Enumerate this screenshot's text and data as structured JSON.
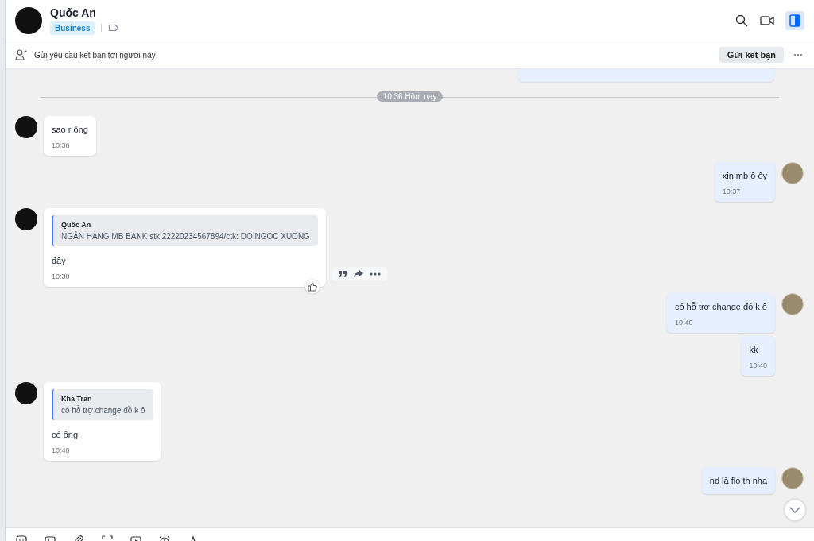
{
  "header": {
    "name": "Quốc An",
    "tag": "Business"
  },
  "friend_bar": {
    "text": "Gửi yêu cầu kết bạn tới người này",
    "button": "Gửi kết bạn"
  },
  "divider": "10:36 Hôm nay",
  "messages": [
    {
      "kind": "incoming",
      "show_avatar": true,
      "hovered": false,
      "text": "sao r ông",
      "time": "10:36"
    },
    {
      "kind": "outgoing",
      "show_avatar": true,
      "hovered": false,
      "text": "xin mb ô êy",
      "time": "10:37"
    },
    {
      "kind": "incoming",
      "show_avatar": true,
      "hovered": true,
      "quote": {
        "author": "Quốc An",
        "text": "NGÂN HÀNG MB BANK stk:22220234567894/ctk: DO NGOC XUONG"
      },
      "text": "đây",
      "time": "10:38"
    },
    {
      "kind": "outgoing",
      "show_avatar": true,
      "hovered": false,
      "text": "có hỗ trợ change đồ k ô",
      "time": "10:40"
    },
    {
      "kind": "outgoing",
      "show_avatar": false,
      "hovered": false,
      "text": "kk",
      "time": "10:40"
    },
    {
      "kind": "incoming",
      "show_avatar": true,
      "hovered": false,
      "quote": {
        "author": "Kha Tran",
        "text": "có hỗ trợ change đồ k ô"
      },
      "text": "có ông",
      "time": "10:40"
    },
    {
      "kind": "outgoing",
      "show_avatar": true,
      "hovered": false,
      "text": "nd là flo th nha"
    }
  ]
}
